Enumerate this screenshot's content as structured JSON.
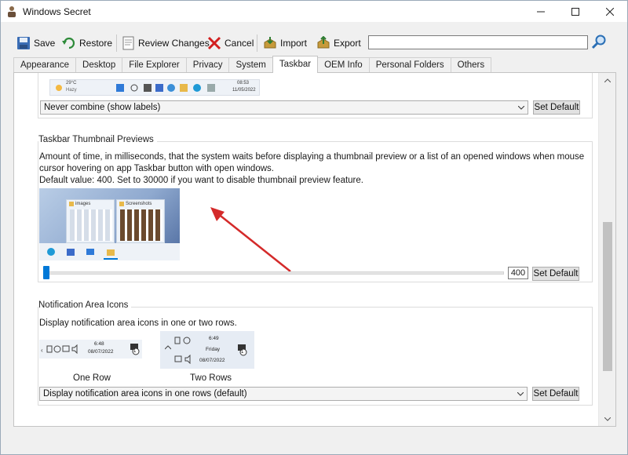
{
  "window": {
    "title": "Windows Secret"
  },
  "toolbar": {
    "save": "Save",
    "restore": "Restore",
    "review": "Review Changes",
    "cancel": "Cancel",
    "import": "Import",
    "export": "Export",
    "search_value": ""
  },
  "tabs": [
    "Appearance",
    "Desktop",
    "File Explorer",
    "Privacy",
    "System",
    "Taskbar",
    "OEM Info",
    "Personal Folders",
    "Others"
  ],
  "active_tab": "Taskbar",
  "combine": {
    "preview_weather": "29°C",
    "preview_weather_sub": "Hazy",
    "preview_time": "08:53",
    "preview_date": "11/05/2022",
    "selected": "Never combine (show labels)",
    "set_default": "Set Default"
  },
  "thumbnail": {
    "title": "Taskbar Thumbnail Previews",
    "description": "Amount of time, in milliseconds, that the system waits before displaying a thumbnail preview or a list of an opened windows when mouse cursor hovering on app Taskbar button with open windows.",
    "default_note": "Default value: 400. Set to 30000 if you want to disable thumbnail preview feature.",
    "preview_label_1": "images",
    "preview_label_2": "Screenshots",
    "value": "400",
    "slider_fraction": 0.01,
    "set_default": "Set Default"
  },
  "notification": {
    "title": "Notification Area Icons",
    "description": "Display notification area icons in one or two rows.",
    "one_row_time": "6:48",
    "one_row_date": "08/07/2022",
    "two_rows_time": "6:49",
    "two_rows_day": "Friday",
    "two_rows_date": "08/07/2022",
    "one_row_caption": "One Row",
    "two_rows_caption": "Two Rows",
    "selected": "Display notification area icons in one rows (default)",
    "set_default": "Set Default",
    "badge": "1"
  },
  "colors": {
    "accent": "#0078d7",
    "arrow": "#d42a2a"
  },
  "icons": [
    "app-icon",
    "save-icon",
    "restore-icon",
    "review-icon",
    "cancel-icon",
    "import-icon",
    "export-icon",
    "search-icon",
    "minimize-icon",
    "maximize-icon",
    "close-icon",
    "chevron-down-icon",
    "chevron-up-icon",
    "annotation-arrow"
  ]
}
